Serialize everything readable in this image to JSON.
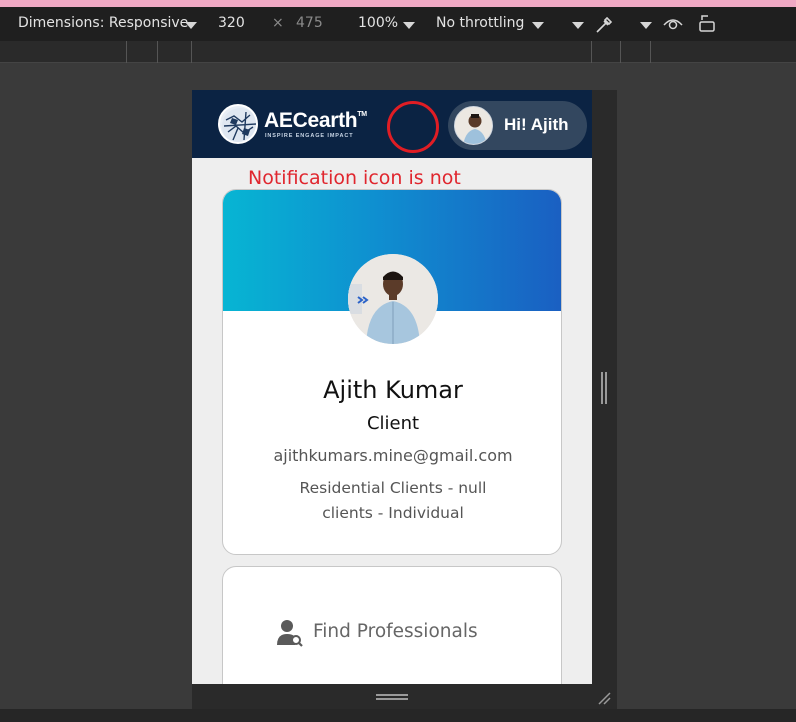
{
  "devtools": {
    "dimensions_label": "Dimensions: Responsive",
    "width_value": "320",
    "times_symbol": "×",
    "height_value": "475",
    "zoom": "100%",
    "throttling": "No throttling"
  },
  "app": {
    "brand": "AECearth",
    "trademark": "TM",
    "tagline": "INSPIRE ENGAGE IMPACT",
    "greeting": "Hi! Ajith"
  },
  "annotation": {
    "text": "Notification icon is not displayed here.",
    "color": "#e01d24"
  },
  "profile": {
    "name": "Ajith Kumar",
    "role": "Client",
    "email": "ajithkumars.mine@gmail.com",
    "client_type": "Residential Clients - null clients - Individual"
  },
  "actions": {
    "find_professionals": "Find Professionals"
  },
  "colors": {
    "header_bg": "#0b2343",
    "banner_start": "#07b5d3",
    "banner_end": "#1a5fc2"
  }
}
